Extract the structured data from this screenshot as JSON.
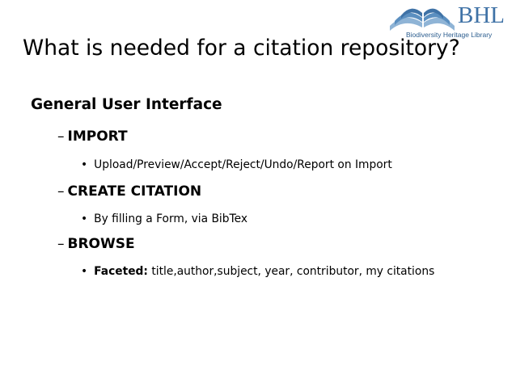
{
  "logo": {
    "wordmark": "BHL",
    "subtitle": "Biodiversity Heritage Library",
    "colors": {
      "primary": "#3f72a6",
      "secondary": "#8fb4d6"
    }
  },
  "title": "What is needed for a citation repository?",
  "section": {
    "heading": "General User Interface",
    "items": [
      {
        "label": "IMPORT",
        "detail_prefix": "",
        "detail": "Upload/Preview/Accept/Reject/Undo/Report on Import"
      },
      {
        "label": "CREATE CITATION",
        "detail_prefix": "",
        "detail": "By filling a Form, via BibTex"
      },
      {
        "label": "BROWSE",
        "detail_prefix": "Faceted:",
        "detail": " title,author,subject, year, contributor, my citations"
      }
    ]
  },
  "glyphs": {
    "dash": "–",
    "bullet": "•"
  }
}
